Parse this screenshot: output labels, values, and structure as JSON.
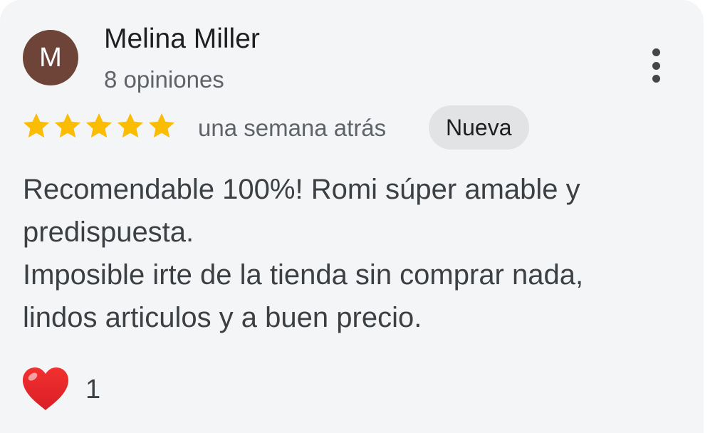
{
  "review": {
    "avatar_letter": "M",
    "avatar_color": "#6d4437",
    "author_name": "Melina Miller",
    "review_count": "8 opiniones",
    "rating": 5,
    "star_color": "#fbbc04",
    "time_ago": "una semana atrás",
    "badge": "Nueva",
    "text_lines": [
      "Recomendable 100%! Romi súper amable y",
      "predispuesta.",
      "Imposible irte de la tienda sin comprar nada,",
      "lindos articulos y a buen precio."
    ],
    "reaction_icon": "heart-icon",
    "reaction_count": "1",
    "menu_icon": "more-vert-icon"
  }
}
